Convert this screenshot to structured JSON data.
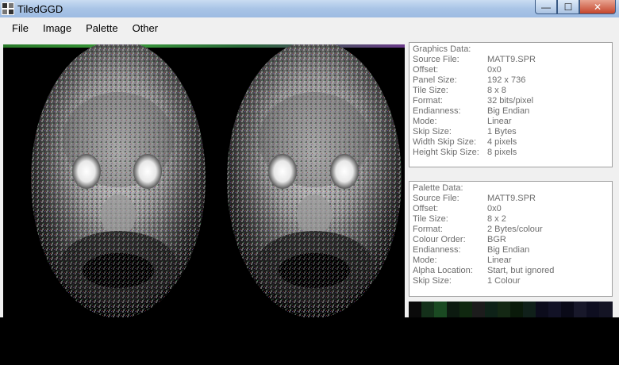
{
  "window": {
    "title": "TiledGGD"
  },
  "window_controls": {
    "minimize": "—",
    "maximize": "☐",
    "close": "✕"
  },
  "menu": [
    {
      "label": "File",
      "name": "menu-file"
    },
    {
      "label": "Image",
      "name": "menu-image"
    },
    {
      "label": "Palette",
      "name": "menu-palette"
    },
    {
      "label": "Other",
      "name": "menu-other"
    }
  ],
  "graphics": {
    "heading": "Graphics Data:",
    "rows": [
      {
        "k": "Source File:",
        "v": "MATT9.SPR"
      },
      {
        "k": "Offset:",
        "v": "0x0"
      },
      {
        "k": "Panel Size:",
        "v": "192 x 736"
      },
      {
        "k": "Tile Size:",
        "v": "8 x 8"
      },
      {
        "k": "Format:",
        "v": "32 bits/pixel"
      },
      {
        "k": "Endianness:",
        "v": "Big Endian"
      },
      {
        "k": "Mode:",
        "v": "Linear"
      },
      {
        "k": "Skip Size:",
        "v": "1 Bytes"
      },
      {
        "k": "Width Skip Size:",
        "v": "4 pixels"
      },
      {
        "k": "Height Skip Size:",
        "v": "8 pixels"
      }
    ]
  },
  "palette": {
    "heading": "Palette Data:",
    "rows": [
      {
        "k": "Source File:",
        "v": "MATT9.SPR"
      },
      {
        "k": "Offset:",
        "v": "0x0"
      },
      {
        "k": "Tile Size:",
        "v": "8 x 2"
      },
      {
        "k": "Format:",
        "v": "2 Bytes/colour"
      },
      {
        "k": "Colour Order:",
        "v": "BGR"
      },
      {
        "k": "Endianness:",
        "v": "Big Endian"
      },
      {
        "k": "Mode:",
        "v": "Linear"
      },
      {
        "k": "Alpha Location:",
        "v": "Start, but ignored"
      },
      {
        "k": "Skip Size:",
        "v": "1 Colour"
      }
    ]
  },
  "colors": {
    "titlebar": "#a9c4e6",
    "window_bg": "#f0f0f0",
    "close_button": "#c4452c"
  }
}
